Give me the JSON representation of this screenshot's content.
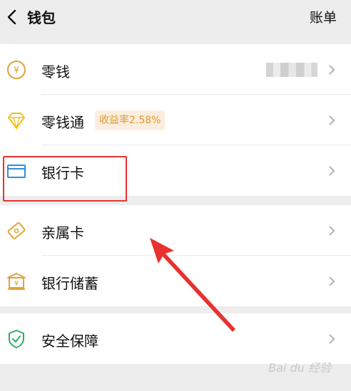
{
  "header": {
    "title": "钱包",
    "bill_label": "账单"
  },
  "group1": {
    "items": [
      {
        "label": "零钱",
        "icon": "yuan-coin-icon"
      },
      {
        "label": "零钱通",
        "icon": "diamond-icon",
        "badge": "收益率2.58%"
      },
      {
        "label": "银行卡",
        "icon": "bank-card-icon"
      }
    ]
  },
  "group2": {
    "items": [
      {
        "label": "亲属卡",
        "icon": "family-card-icon"
      },
      {
        "label": "银行储蓄",
        "icon": "bank-building-icon"
      }
    ]
  },
  "group3": {
    "items": [
      {
        "label": "安全保障",
        "icon": "shield-check-icon"
      }
    ]
  },
  "watermark": "Bai du 经验",
  "colors": {
    "highlight": "#e8322f",
    "badge_bg": "#fbeede",
    "badge_text": "#e09a2f",
    "security_green": "#2aae67",
    "card_blue": "#2f8fd8",
    "gold": "#e0a43a"
  }
}
